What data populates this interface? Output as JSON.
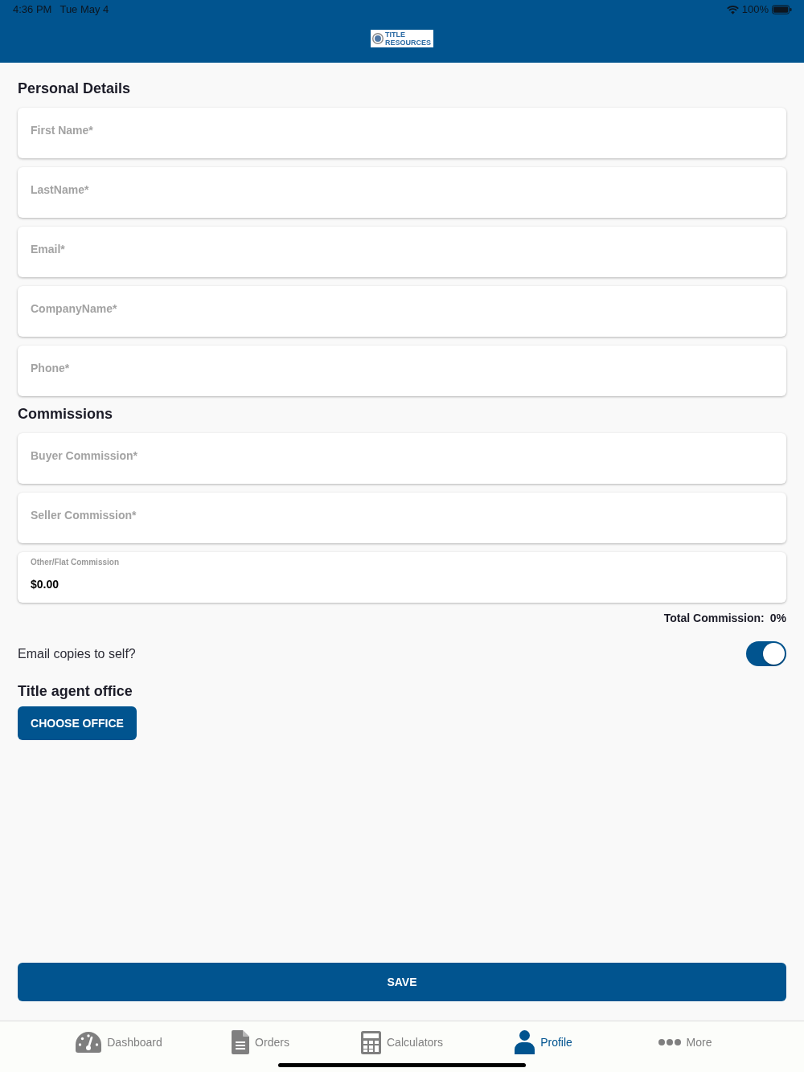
{
  "status_bar": {
    "time": "4:36 PM",
    "date": "Tue May 4",
    "battery": "100%"
  },
  "header": {
    "logo_text": [
      "TITLE",
      "RESOURCES"
    ]
  },
  "sections": [
    {
      "title": "Personal Details",
      "fields": [
        {
          "kind": "empty",
          "placeholder": "First Name*"
        },
        {
          "kind": "empty",
          "placeholder": "LastName*"
        },
        {
          "kind": "empty",
          "placeholder": "Email*"
        },
        {
          "kind": "empty",
          "placeholder": "CompanyName*"
        },
        {
          "kind": "empty",
          "placeholder": "Phone*"
        }
      ]
    },
    {
      "title": "Commissions",
      "fields": [
        {
          "kind": "empty",
          "placeholder": "Buyer Commission*"
        },
        {
          "kind": "empty",
          "placeholder": "Seller Commission*"
        },
        {
          "kind": "filled",
          "label": "Other/Flat Commission",
          "value": "$0.00"
        }
      ]
    }
  ],
  "total_commission": {
    "label": "Total Commission:",
    "value": "0%"
  },
  "email_copies": {
    "label": "Email copies to self?",
    "on": true
  },
  "office": {
    "title": "Title agent office",
    "button": "CHOOSE OFFICE"
  },
  "save_button": "SAVE",
  "tab_bar": [
    {
      "label": "Dashboard",
      "selected": false
    },
    {
      "label": "Orders",
      "selected": false
    },
    {
      "label": "Calculators",
      "selected": false
    },
    {
      "label": "Profile",
      "selected": true
    },
    {
      "label": "More",
      "selected": false
    }
  ]
}
